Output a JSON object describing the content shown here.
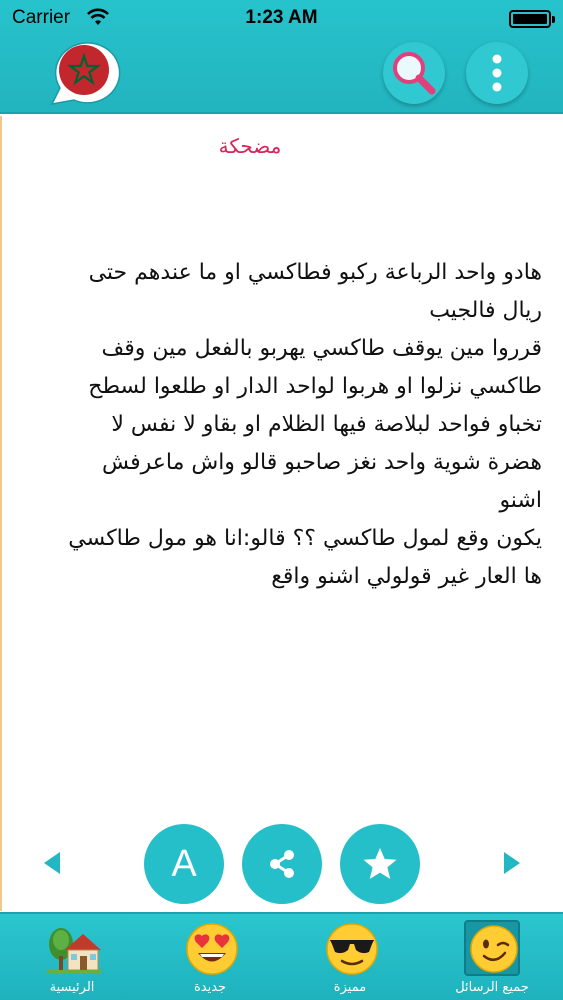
{
  "status_bar": {
    "carrier": "Carrier",
    "time": "1:23 AM"
  },
  "header": {
    "logo_icon": "morocco-flag-speech-bubble-icon",
    "search_icon": "magnifier-icon",
    "menu_icon": "vertical-dots-icon"
  },
  "message": {
    "title": "مضحكة",
    "lines": [
      "هادو واحد الرباعة ركبو فطاكسي او ما عندهم حتى",
      "ريال فالجيب",
      "قرروا مين يوقف طاكسي يهربو بالفعل مين وقف",
      "طاكسي نزلوا او هربوا لواحد الدار او طلعوا لسطح",
      "تخباو فواحد لبلاصة فيها الظلام او بقاو لا نفس لا",
      "هضرة شوية واحد نغز صاحبو قالو واش ماعرفش",
      "اشنو",
      "يكون وقع لمول طاكسي ؟؟ قالو:انا هو مول طاكسي",
      "ها العار غير قولولي اشنو واقع"
    ]
  },
  "actions": {
    "font_size_label": "A",
    "share_icon": "share-icon",
    "favorite_icon": "star-icon"
  },
  "tabs": [
    {
      "label": "الرئيسية",
      "icon": "house-icon"
    },
    {
      "label": "جديدة",
      "icon": "heart-eyes-emoji-icon"
    },
    {
      "label": "مميزة",
      "icon": "sunglasses-emoji-icon"
    },
    {
      "label": "جميع الرسائل",
      "icon": "wink-emoji-icon",
      "selected": true
    }
  ],
  "colors": {
    "header_teal": "#27c3cc",
    "title_red": "#d8255a",
    "button_teal": "#25bfca"
  }
}
